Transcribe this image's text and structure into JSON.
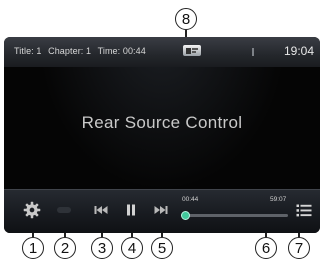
{
  "status": {
    "title_text": "Title: 1",
    "chapter_text": "Chapter: 1",
    "time_text": "Time: 00:44",
    "clock": "19:04"
  },
  "main": {
    "label": "Rear Source Control"
  },
  "controls": {
    "settings_icon": "gear-icon",
    "button2_icon": "dim-button-icon",
    "previous_icon": "skip-previous-icon",
    "pause_icon": "pause-icon",
    "next_icon": "skip-next-icon",
    "menu_icon": "list-menu-icon"
  },
  "progress": {
    "elapsed": "00:44",
    "total": "59:07",
    "fraction": 0.012
  },
  "callouts": [
    "1",
    "2",
    "3",
    "4",
    "5",
    "6",
    "7",
    "8"
  ],
  "colors": {
    "screen_bg": "#050505",
    "progress_accent": "#42c99c",
    "status_text": "#d7d7d7"
  }
}
